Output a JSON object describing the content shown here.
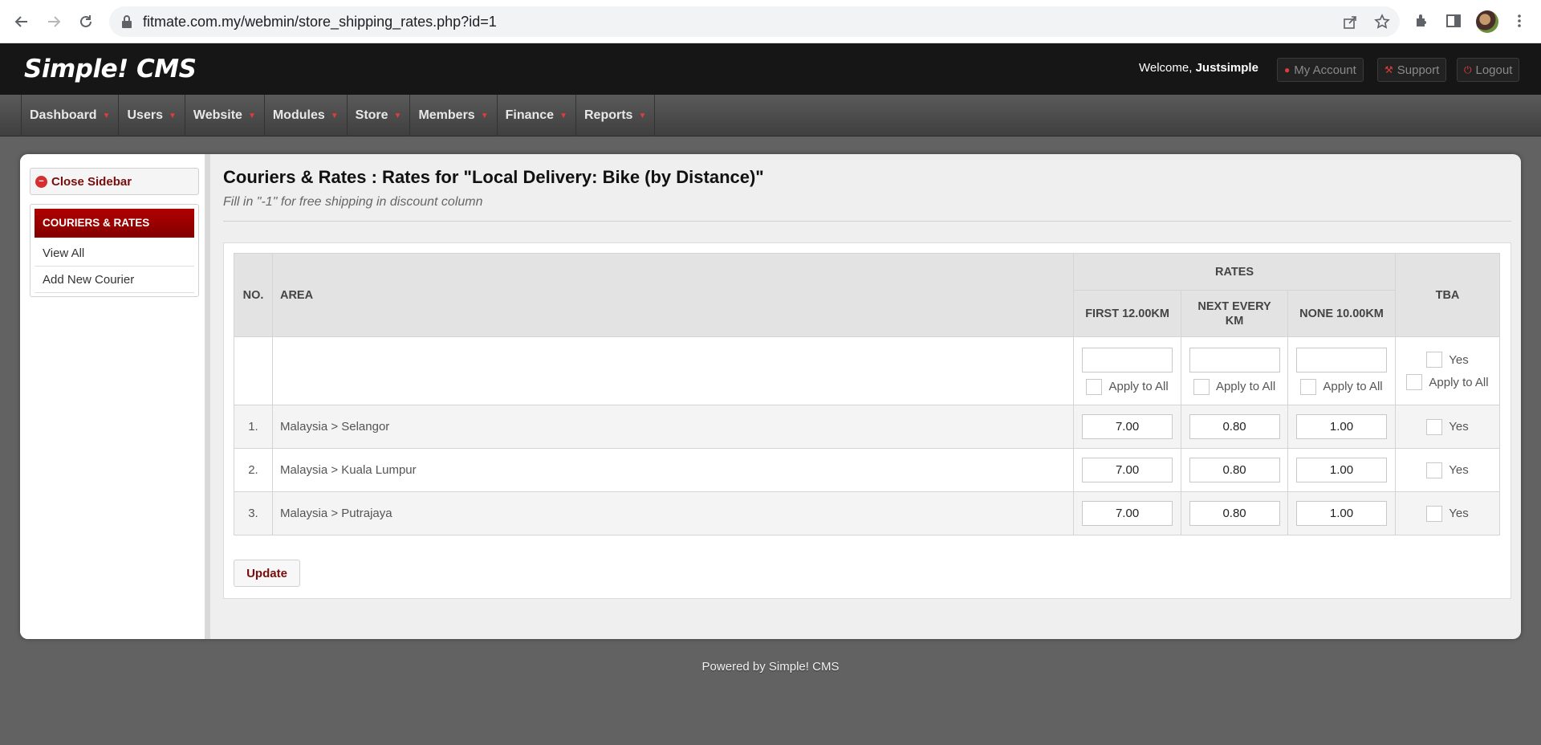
{
  "browser": {
    "url": "fitmate.com.my/webmin/store_shipping_rates.php?id=1"
  },
  "header": {
    "logo": "Simple! CMS",
    "welcome_prefix": "Welcome, ",
    "username": "Justsimple",
    "my_account": "My Account",
    "support": "Support",
    "logout": "Logout"
  },
  "menu": [
    "Dashboard",
    "Users",
    "Website",
    "Modules",
    "Store",
    "Members",
    "Finance",
    "Reports"
  ],
  "sidebar": {
    "close_label": "Close Sidebar",
    "section_title": "COURIERS & RATES",
    "links": [
      "View All",
      "Add New Courier"
    ]
  },
  "page": {
    "title": "Couriers & Rates : Rates for \"Local Delivery: Bike (by Distance)\"",
    "subtitle": "Fill in \"-1\" for free shipping in discount column"
  },
  "table": {
    "col_no": "NO.",
    "col_area": "AREA",
    "col_rates": "RATES",
    "col_first": "FIRST 12.00KM",
    "col_next": "NEXT EVERY KM",
    "col_none": "NONE 10.00KM",
    "col_tba": "TBA",
    "apply_to_all": "Apply to All",
    "yes": "Yes",
    "rows": [
      {
        "no": "1.",
        "area": "Malaysia > Selangor",
        "first": "7.00",
        "next": "0.80",
        "none": "1.00"
      },
      {
        "no": "2.",
        "area": "Malaysia > Kuala Lumpur",
        "first": "7.00",
        "next": "0.80",
        "none": "1.00"
      },
      {
        "no": "3.",
        "area": "Malaysia > Putrajaya",
        "first": "7.00",
        "next": "0.80",
        "none": "1.00"
      }
    ]
  },
  "update_label": "Update",
  "footer": "Powered by Simple! CMS"
}
